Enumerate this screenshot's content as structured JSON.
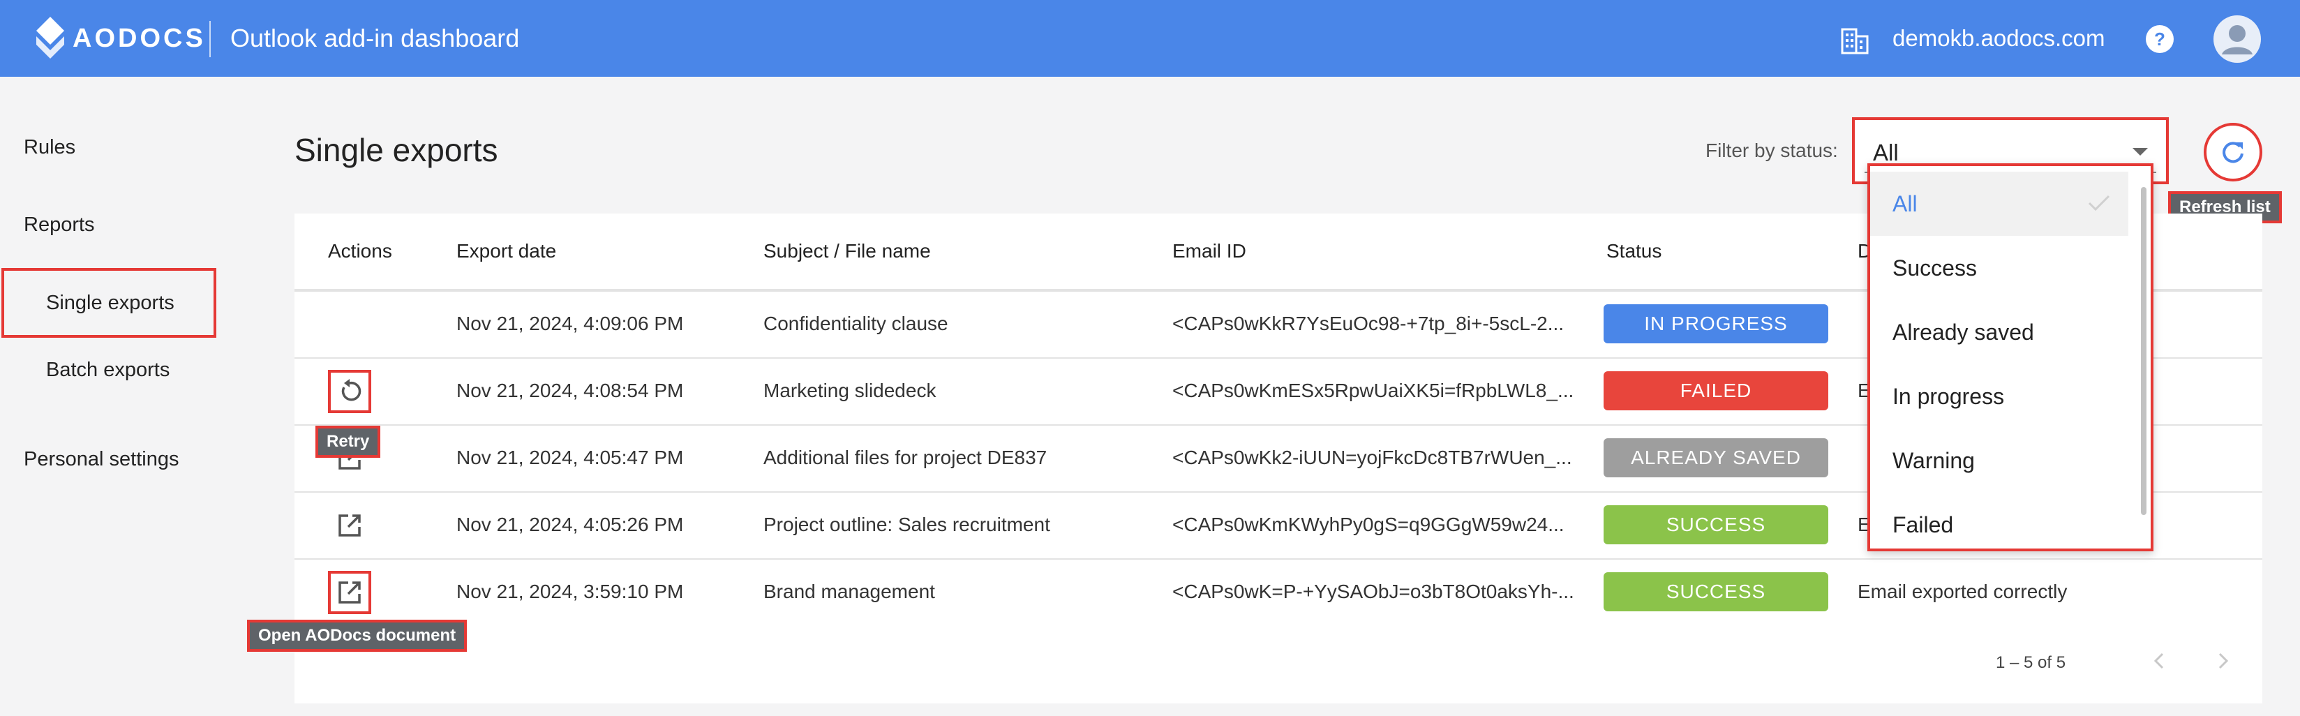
{
  "header": {
    "brand": "AODOCS",
    "title": "Outlook add-in dashboard",
    "domain": "demokb.aodocs.com"
  },
  "sidebar": {
    "items": [
      {
        "label": "Rules"
      },
      {
        "label": "Reports"
      },
      {
        "label": "Single exports"
      },
      {
        "label": "Batch exports"
      },
      {
        "label": "Personal settings"
      }
    ]
  },
  "main": {
    "title": "Single exports",
    "filter_label": "Filter by status:",
    "filter_value": "All",
    "refresh_tooltip": "Refresh list",
    "retry_tooltip": "Retry",
    "open_tooltip": "Open AODocs document"
  },
  "table": {
    "columns": [
      "Actions",
      "Export date",
      "Subject / File name",
      "Email ID",
      "Status",
      "D"
    ],
    "rows": [
      {
        "action": "none",
        "date": "Nov 21, 2024, 4:09:06 PM",
        "subject": "Confidentiality clause",
        "email": "<CAPs0wKkR7YsEuOc98-+7tp_8i+-5scL-2...",
        "status": "IN PROGRESS",
        "status_color": "#4a86e8",
        "details": ""
      },
      {
        "action": "retry",
        "date": "Nov 21, 2024, 4:08:54 PM",
        "subject": "Marketing slidedeck",
        "email": "<CAPs0wKmESx5RpwUaiXK5i=fRpbLWL8_...",
        "status": "FAILED",
        "status_color": "#e8453c",
        "details": "E"
      },
      {
        "action": "open",
        "date": "Nov 21, 2024, 4:05:47 PM",
        "subject": "Additional files for project DE837",
        "email": "<CAPs0wKk2-iUUN=yojFkcDc8TB7rWUen_...",
        "status": "ALREADY SAVED",
        "status_color": "#9e9e9e",
        "details": ""
      },
      {
        "action": "open",
        "date": "Nov 21, 2024, 4:05:26 PM",
        "subject": "Project outline: Sales recruitment",
        "email": "<CAPs0wKmKWyhPy0gS=q9GGgW59w24...",
        "status": "SUCCESS",
        "status_color": "#8bc34a",
        "details": "E"
      },
      {
        "action": "open",
        "date": "Nov 21, 2024, 3:59:10 PM",
        "subject": "Brand management",
        "email": "<CAPs0wK=P-+YySAObJ=o3bT8Ot0aksYh-...",
        "status": "SUCCESS",
        "status_color": "#8bc34a",
        "details": "Email exported correctly"
      }
    ],
    "pagination": "1 – 5 of 5"
  },
  "dropdown": {
    "options": [
      "All",
      "Success",
      "Already saved",
      "In progress",
      "Warning",
      "Failed"
    ],
    "selected": "All"
  },
  "icons": {
    "logo": "aodocs-logo-icon",
    "domain": "building-icon",
    "help": "help-icon",
    "avatar": "account-circle-icon",
    "refresh": "refresh-icon",
    "retry": "retry-icon",
    "open": "open-in-new-icon",
    "check": "check-icon"
  },
  "colors": {
    "header": "#4a86e8",
    "highlight": "#e53935"
  }
}
